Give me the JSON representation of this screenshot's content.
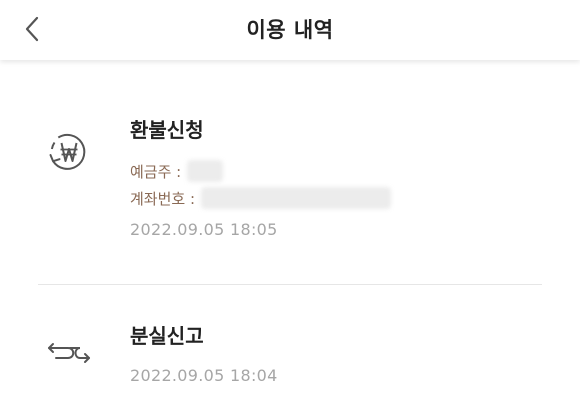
{
  "header": {
    "back_icon": "chevron-left-icon",
    "title": "이용 내역"
  },
  "items": [
    {
      "icon": "won-refund-icon",
      "title": "환불신청",
      "holder_label": "예금주 :",
      "account_label": "계좌번호 :",
      "date": "2022.09.05 18:05"
    },
    {
      "icon": "transfer-arrows-icon",
      "title": "분실신고",
      "date": "2022.09.05 18:04"
    }
  ],
  "colors": {
    "title_text": "#222222",
    "detail_label": "#8a6a55",
    "date_text": "#a6a6a6",
    "divider": "#e6e6e6"
  }
}
